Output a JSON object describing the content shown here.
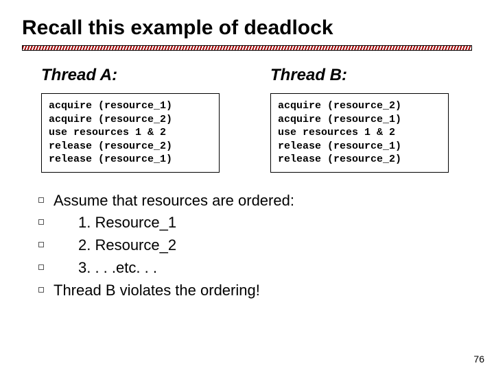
{
  "title": "Recall this example of deadlock",
  "threadA": {
    "heading": "Thread A:",
    "code": "acquire (resource_1)\nacquire (resource_2)\nuse resources 1 & 2\nrelease (resource_2)\nrelease (resource_1)"
  },
  "threadB": {
    "heading": "Thread B:",
    "code": "acquire (resource_2)\nacquire (resource_1)\nuse resources 1 & 2\nrelease (resource_1)\nrelease (resource_2)"
  },
  "bullets": {
    "assume": "Assume that resources are ordered:",
    "r1": "1.   Resource_1",
    "r2": "2.   Resource_2",
    "r3": "3.   . . .etc. . .",
    "violates": "Thread B violates the ordering!"
  },
  "page": "76"
}
